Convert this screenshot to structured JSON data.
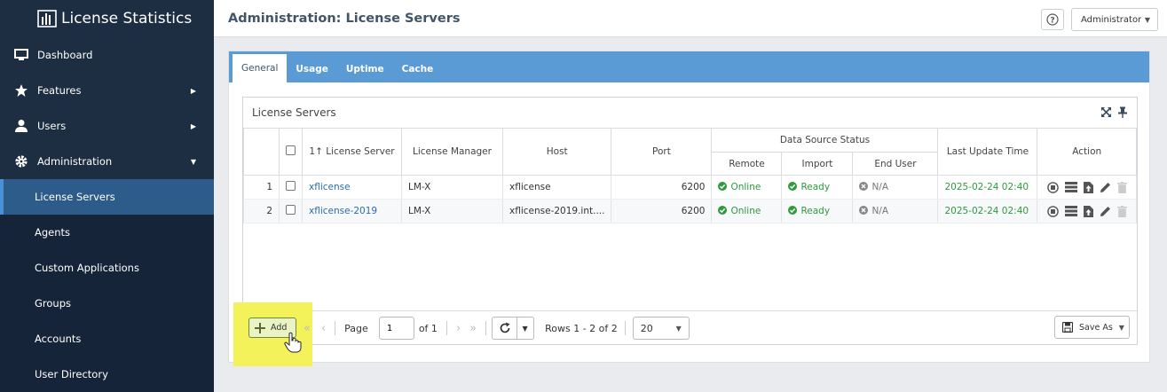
{
  "app": {
    "name": "License Statistics"
  },
  "sidebar": {
    "items": [
      {
        "label": "Dashboard",
        "icon": "monitor-icon"
      },
      {
        "label": "Features",
        "icon": "star-icon"
      },
      {
        "label": "Users",
        "icon": "user-icon"
      },
      {
        "label": "Administration",
        "icon": "gear-icon"
      }
    ],
    "sub_items": [
      {
        "label": "License Servers",
        "active": true
      },
      {
        "label": "Agents"
      },
      {
        "label": "Custom Applications"
      },
      {
        "label": "Groups"
      },
      {
        "label": "Accounts"
      },
      {
        "label": "User Directory"
      }
    ]
  },
  "header": {
    "title": "Administration: License Servers",
    "user_menu": "Administrator"
  },
  "tabs": [
    "General",
    "Usage",
    "Uptime",
    "Cache"
  ],
  "panel": {
    "title": "License Servers",
    "columns": {
      "license_server": "License Server",
      "license_manager": "License Manager",
      "host": "Host",
      "port": "Port",
      "data_source_status": "Data Source Status",
      "remote": "Remote",
      "import": "Import",
      "end_user": "End User",
      "last_update": "Last Update Time",
      "action": "Action",
      "sort_indicator": "1"
    },
    "rows": [
      {
        "n": "1",
        "server": "xflicense",
        "manager": "LM-X",
        "host": "xflicense",
        "port": "6200",
        "remote": "Online",
        "import": "Ready",
        "end_user": "N/A",
        "updated": "2025-02-24 02:40"
      },
      {
        "n": "2",
        "server": "xflicense-2019",
        "manager": "LM-X",
        "host": "xflicense-2019.int....",
        "port": "6200",
        "remote": "Online",
        "import": "Ready",
        "end_user": "N/A",
        "updated": "2025-02-24 02:40"
      }
    ]
  },
  "footer": {
    "add_label": "Add",
    "page_label": "Page",
    "page_value": "1",
    "of_label": "of 1",
    "rows_label": "Rows 1 - 2 of 2",
    "page_size": "20",
    "save_as": "Save As"
  },
  "colors": {
    "sidebar": "#1d2d42",
    "accent": "#5b9bd5",
    "status_ok": "#2e9a3d",
    "highlight": "#f4f25a"
  }
}
